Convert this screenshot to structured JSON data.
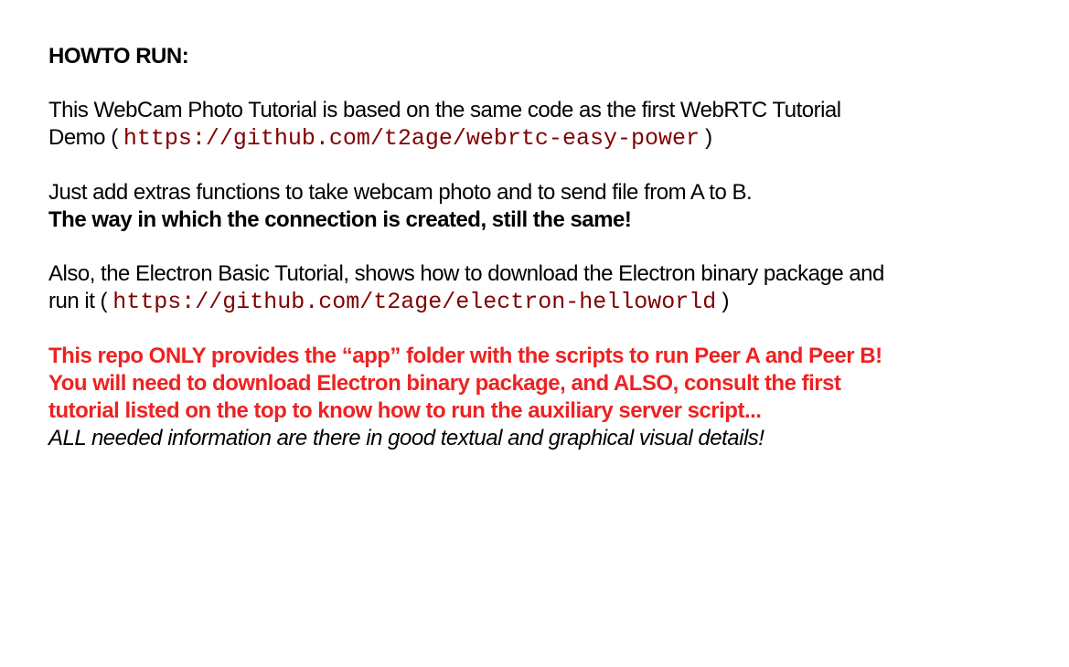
{
  "heading": "HOWTO RUN:",
  "para1": {
    "text": "This WebCam Photo Tutorial is based on the same code as the first WebRTC Tutorial",
    "line2_prefix": "Demo ( ",
    "link": "https://github.com/t2age/webrtc-easy-power",
    "line2_suffix": " )"
  },
  "para2": {
    "line1": "Just add extras functions to take webcam photo and to send file from A to B.",
    "line2_bold": "The way in which the connection is created, still the same!"
  },
  "para3": {
    "text": "Also, the Electron Basic Tutorial, shows how to download the Electron binary package and",
    "line2_prefix": "run it ( ",
    "link": "https://github.com/t2age/electron-helloworld",
    "line2_suffix": " )"
  },
  "para4": {
    "red_line1": "This repo ONLY provides the “app” folder with the scripts to run Peer A and Peer B!",
    "red_line2": "You will need to download Electron binary package, and ALSO, consult the first",
    "red_line3": "tutorial listed on the top to know how to run the auxiliary server script...",
    "italic_line": "ALL needed information are there in good textual and graphical visual details!"
  },
  "colors": {
    "link": "#800000",
    "warning": "#ee2222",
    "text": "#000000"
  }
}
